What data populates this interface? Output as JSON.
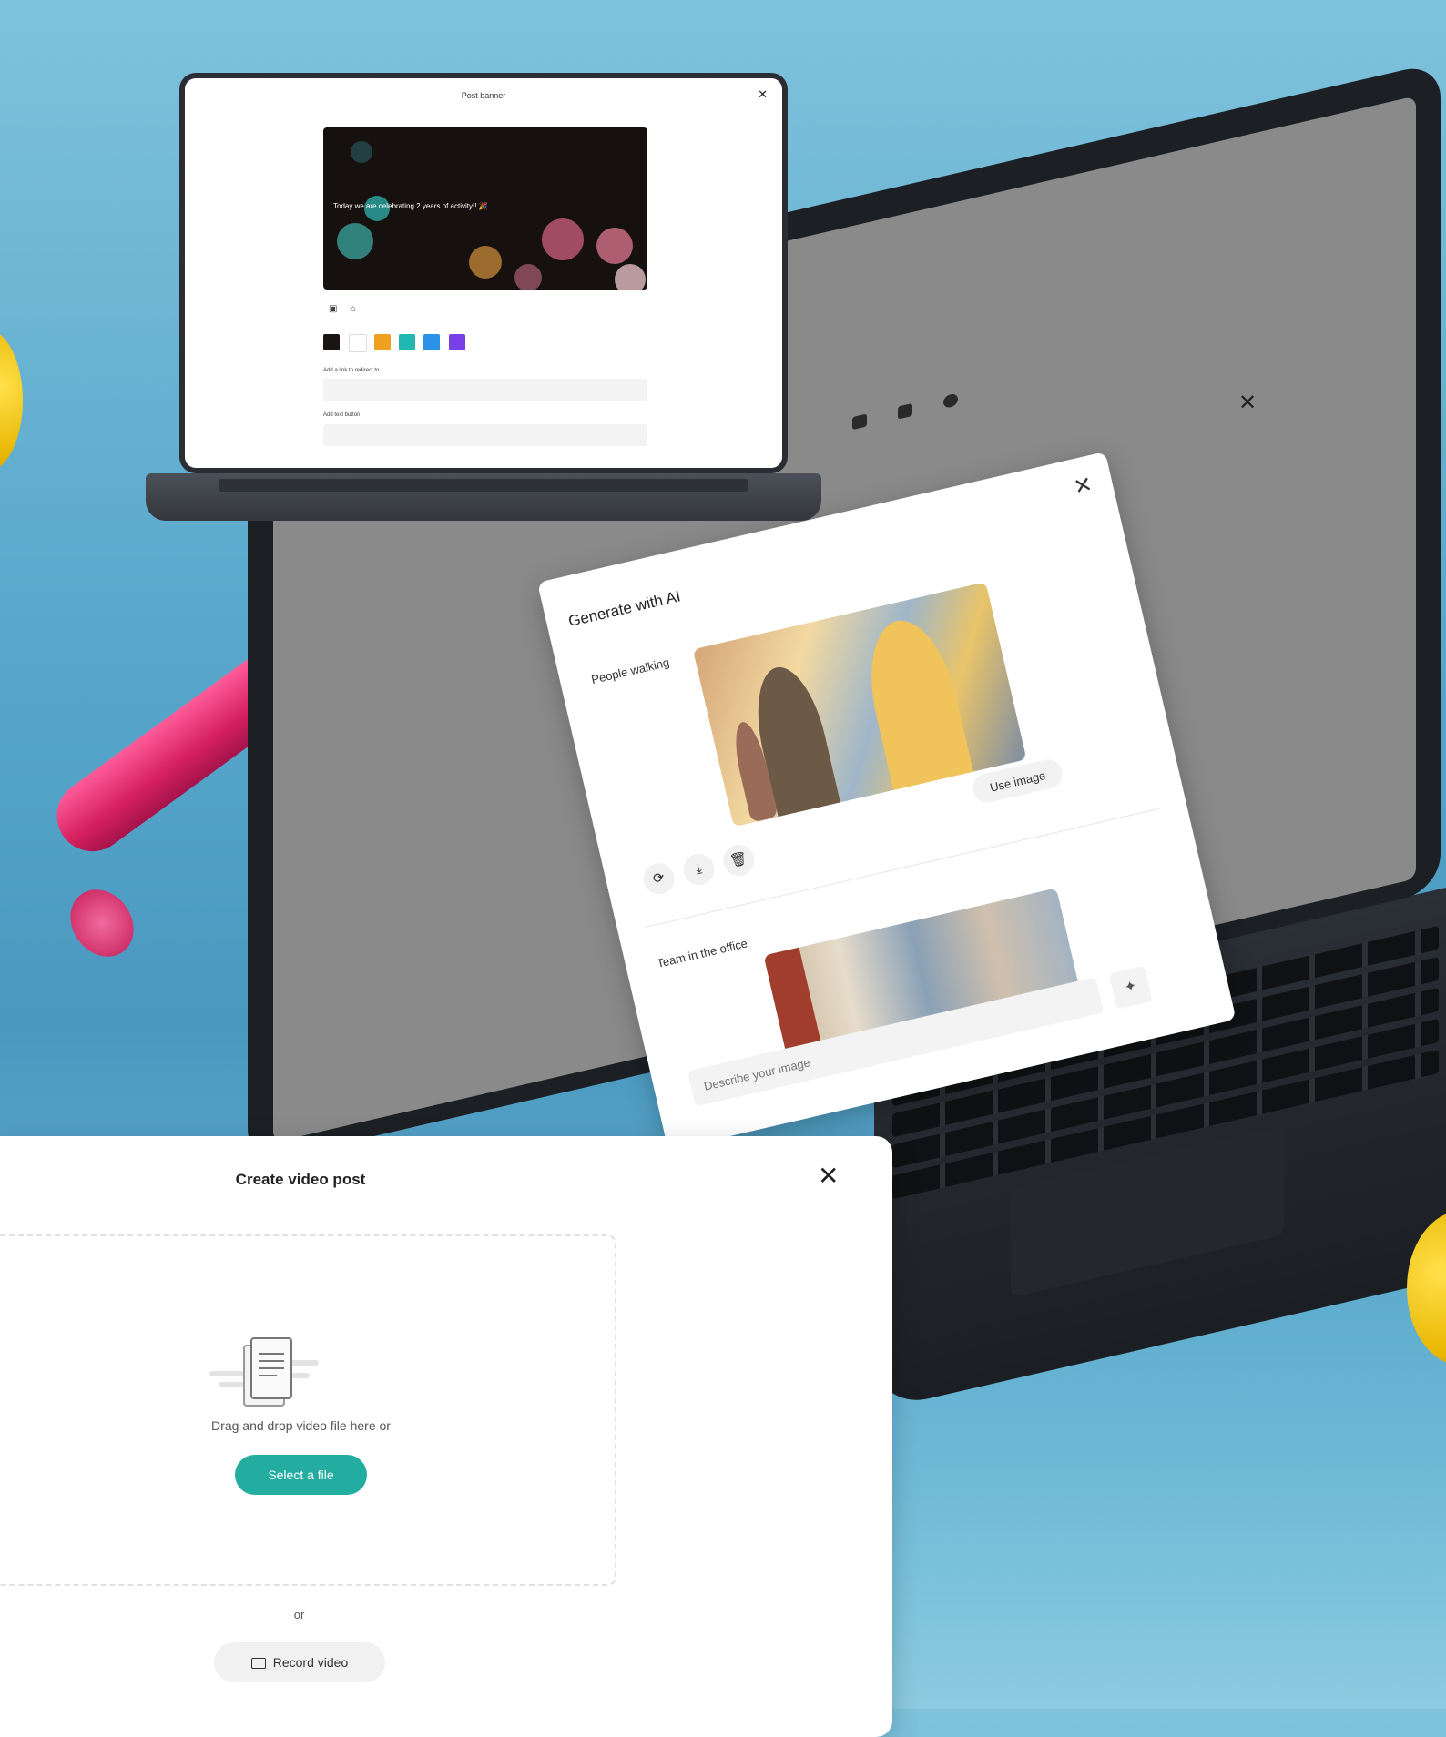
{
  "small_laptop": {
    "modal_title": "Post banner",
    "close_symbol": "✕",
    "banner_text": "Today we are celebrating 2 years of activity!! 🎉",
    "tool_icons": [
      "image-icon",
      "trash-icon"
    ],
    "swatch_colors": [
      "#1a1512",
      "#ffffff",
      "#f0a020",
      "#20b8b0",
      "#2a90e8",
      "#7a40e8"
    ],
    "link_label": "Add a link to redirect to",
    "button_label": "Add text button"
  },
  "ai_modal": {
    "title": "Generate with AI",
    "close_symbol": "✕",
    "prompt_1": "People walking",
    "use_image_label": "Use image",
    "action_icons": [
      "refresh-icon",
      "download-icon",
      "trash-icon"
    ],
    "prompt_2": "Team in the office",
    "input_placeholder": "Describe your image",
    "toolbar_icons": [
      "link-icon",
      "image-icon",
      "mic-icon",
      "photo-icon",
      "video-icon",
      "document-icon",
      "gallery-icon",
      "info-icon"
    ]
  },
  "big_laptop": {
    "close_symbol": "✕"
  },
  "video_modal": {
    "title": "Create video post",
    "close_symbol": "✕",
    "dropzone_text": "Drag and drop video file here or",
    "select_label": "Select a file",
    "or_text": "or",
    "record_label": "Record video",
    "accent_color": "#23ada1"
  }
}
